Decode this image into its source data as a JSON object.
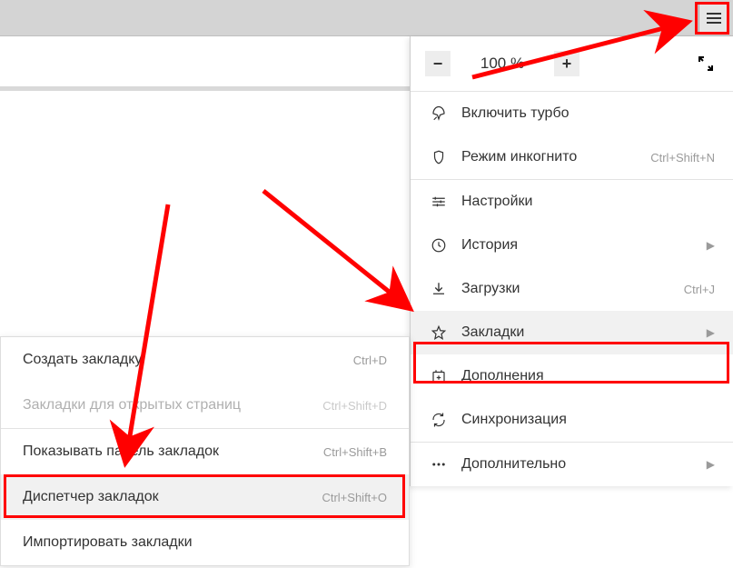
{
  "zoom": {
    "level": "100 %"
  },
  "menu": {
    "turbo": "Включить турбо",
    "incognito": {
      "label": "Режим инкогнито",
      "shortcut": "Ctrl+Shift+N"
    },
    "settings": "Настройки",
    "history": "История",
    "downloads": {
      "label": "Загрузки",
      "shortcut": "Ctrl+J"
    },
    "bookmarks": "Закладки",
    "addons": "Дополнения",
    "sync": "Синхронизация",
    "more": "Дополнительно"
  },
  "submenu": {
    "create": {
      "label": "Создать закладку",
      "shortcut": "Ctrl+D"
    },
    "openTabs": {
      "label": "Закладки для открытых страниц",
      "shortcut": "Ctrl+Shift+D"
    },
    "showBar": {
      "label": "Показывать панель закладок",
      "shortcut": "Ctrl+Shift+B"
    },
    "manager": {
      "label": "Диспетчер закладок",
      "shortcut": "Ctrl+Shift+O"
    },
    "import": "Импортировать закладки"
  }
}
